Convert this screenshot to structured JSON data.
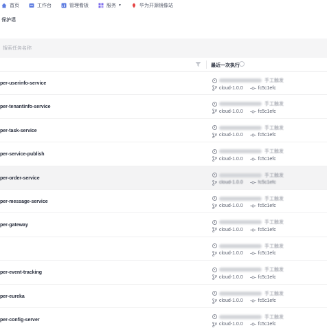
{
  "topnav": {
    "items": [
      {
        "label": "首页",
        "icon": "home-icon",
        "color": "#5e7ce0"
      },
      {
        "label": "工作台",
        "icon": "workbench-icon",
        "color": "#5e7ce0"
      },
      {
        "label": "管理看板",
        "icon": "dashboard-icon",
        "color": "#5e7ce0"
      },
      {
        "label": "服务",
        "icon": "service-icon",
        "color": "#7b69ee",
        "dropdown": true
      },
      {
        "label": "华为开源镜像站",
        "icon": "mirror-icon",
        "color": "#e54545"
      }
    ]
  },
  "page": {
    "title": "保护墙"
  },
  "search": {
    "placeholder": "搜索任务名称"
  },
  "table": {
    "column_title": "最近一次执行",
    "rows": [
      {
        "name": "per-userinfo-service",
        "trigger": "手工触发",
        "branch": "cloud-1.0.0",
        "commit": "fc5c1efc"
      },
      {
        "name": "per-tenantinfo-service",
        "trigger": "手工触发",
        "branch": "cloud-1.0.0",
        "commit": "fc5c1efc"
      },
      {
        "name": "per-task-service",
        "trigger": "手工触发",
        "branch": "cloud-1.0.0",
        "commit": "fc5c1efc"
      },
      {
        "name": "per-service-publish",
        "trigger": "手工触发",
        "branch": "cloud-1.0.0",
        "commit": "fc5c1efc"
      },
      {
        "name": "per-order-service",
        "trigger": "手工触发",
        "branch": "cloud-1.0.0",
        "commit": "fc5c1efc"
      },
      {
        "name": "per-message-service",
        "trigger": "手工触发",
        "branch": "cloud-1.0.0",
        "commit": "fc5c1efc"
      },
      {
        "name": "per-gateway",
        "trigger": "手工触发",
        "branch": "cloud-1.0.0",
        "commit": "fc5c1efc"
      },
      {
        "name": "",
        "trigger": "手工触发",
        "branch": "cloud-1.0.0",
        "commit": "fc5c1efc"
      },
      {
        "name": "per-event-tracking",
        "trigger": "手工触发",
        "branch": "cloud-1.0.0",
        "commit": "fc5c1efc"
      },
      {
        "name": "per-eureka",
        "trigger": "手工触发",
        "branch": "cloud-1.0.0",
        "commit": "fc5c1efc"
      },
      {
        "name": "per-config-server",
        "trigger": "手工触发",
        "branch": "cloud-1.0.0",
        "commit": "fc5c1efc"
      }
    ]
  }
}
